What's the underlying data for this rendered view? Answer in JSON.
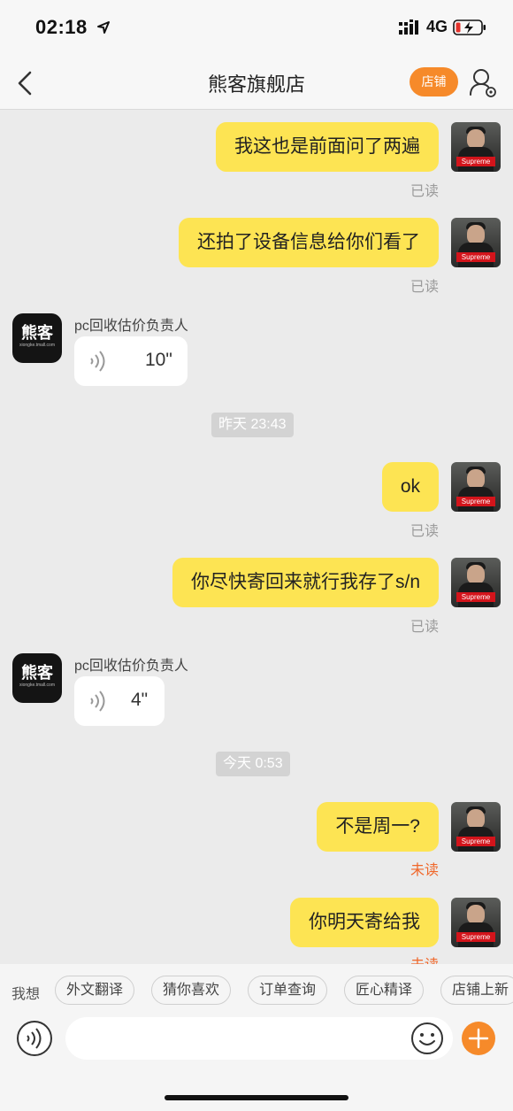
{
  "status_bar": {
    "time": "02:18",
    "network": "4G"
  },
  "nav": {
    "title": "熊客旗舰店",
    "shop_button": "店铺"
  },
  "me_avatar_tag": "Supreme",
  "shop_avatar": {
    "logo_text": "熊客",
    "logo_sub": "xiongke.tmall.com"
  },
  "messages": [
    {
      "type": "out",
      "text": "我这也是前面问了两遍",
      "status": "已读"
    },
    {
      "type": "out",
      "text": "还拍了设备信息给你们看了",
      "status": "已读"
    },
    {
      "type": "in_voice",
      "sender": "pc回收估价负责人",
      "duration": "10\""
    },
    {
      "type": "timestamp",
      "text": "昨天 23:43"
    },
    {
      "type": "out",
      "text": "ok",
      "status": "已读"
    },
    {
      "type": "out",
      "text": "你尽快寄回来就行我存了s/n",
      "status": "已读"
    },
    {
      "type": "in_voice",
      "sender": "pc回收估价负责人",
      "duration": "4\""
    },
    {
      "type": "timestamp",
      "text": "今天 0:53"
    },
    {
      "type": "out",
      "text": "不是周一?",
      "status": "未读"
    },
    {
      "type": "out",
      "text": "你明天寄给我",
      "status": "未读"
    }
  ],
  "quick_replies": {
    "label": "我想",
    "chips": [
      "外文翻译",
      "猜你喜欢",
      "订单查询",
      "匠心精译",
      "店铺上新"
    ]
  },
  "input": {
    "placeholder": ""
  },
  "colors": {
    "accent": "#f68a2a",
    "bubble_me": "#fde453",
    "unread": "#f0672a"
  }
}
